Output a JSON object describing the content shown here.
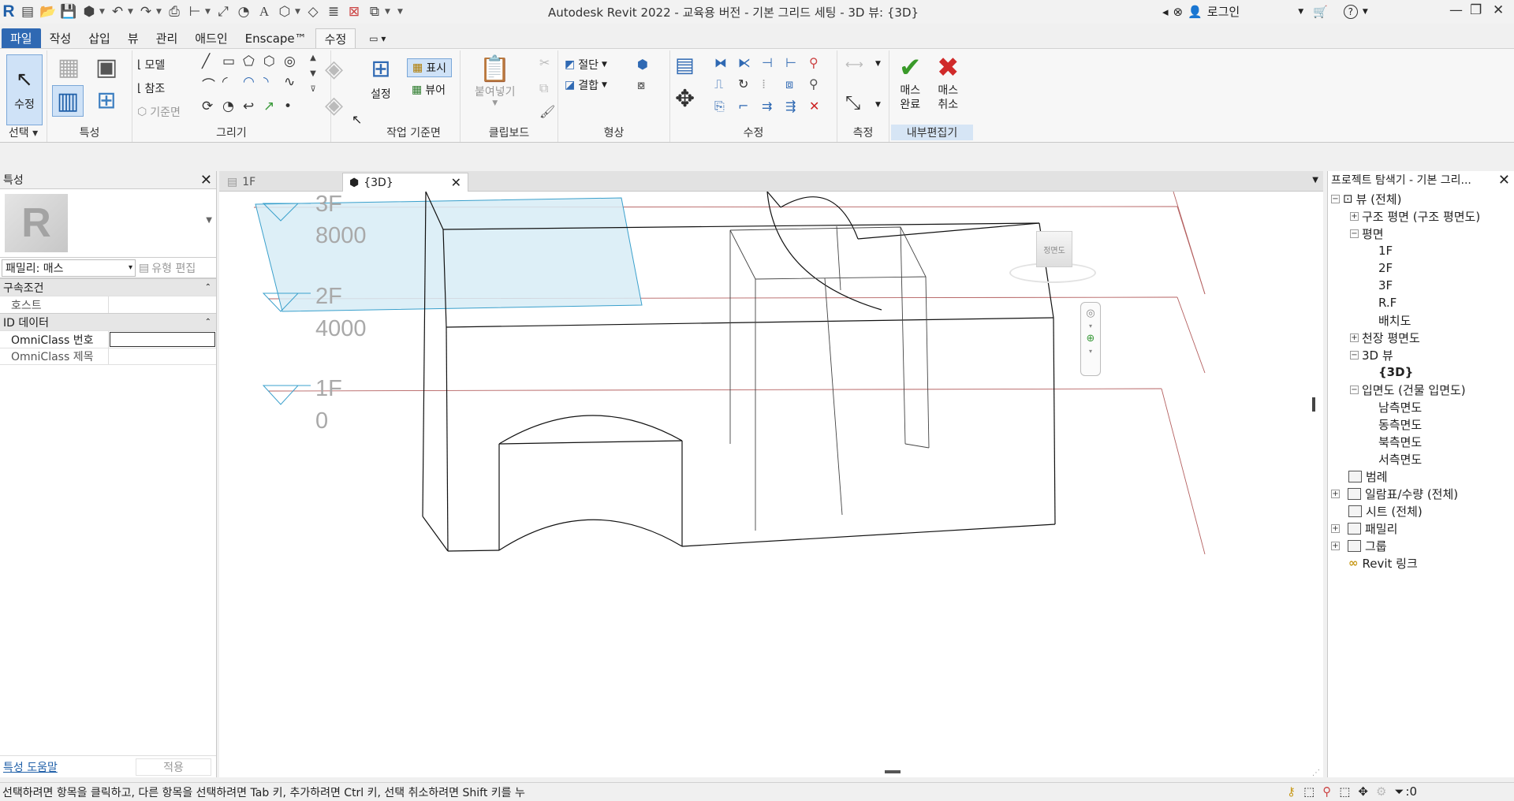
{
  "app": {
    "title": "Autodesk Revit 2022 - 교육용 버전 - 기본 그리드 세팅 - 3D 뷰: {3D}",
    "login": "로그인"
  },
  "colors": {
    "accent": "#2f69b3",
    "mass_fill": "#d7ecf6",
    "mass_stroke": "#3aa0cc",
    "level_line": "#b46060",
    "level_text": "#a9a9a9"
  },
  "ribbon_tabs": [
    "파일",
    "작성",
    "삽입",
    "뷰",
    "관리",
    "애드인",
    "Enscape™",
    "수정"
  ],
  "ribbon": {
    "select": {
      "modify_label": "수정",
      "panel": "선택"
    },
    "properties": {
      "panel": "특성"
    },
    "draw": {
      "model": "모델",
      "reference": "참조",
      "baseline": "기준면",
      "panel": "그리기"
    },
    "workplane": {
      "set": "설정",
      "show": "표시",
      "viewer": "뷰어",
      "panel": "작업 기준면"
    },
    "clipboard": {
      "paste": "붙여넣기",
      "panel": "클립보드"
    },
    "geometry": {
      "cut": "절단",
      "join": "결합",
      "panel": "형상"
    },
    "modify": {
      "panel": "수정"
    },
    "measure": {
      "panel": "측정"
    },
    "inplace": {
      "finish_1": "매스",
      "finish_2": "완료",
      "cancel_1": "매스",
      "cancel_2": "취소",
      "panel": "내부편집기"
    }
  },
  "properties": {
    "title": "특성",
    "family": "패밀리: 매스",
    "edit_type": "유형 편집",
    "sections": {
      "constraints": "구속조건",
      "id_data": "ID 데이터"
    },
    "rows": {
      "host": "호스트",
      "omni_num": "OmniClass 번호",
      "omni_title": "OmniClass 제목"
    },
    "help": "특성 도움말",
    "apply": "적용"
  },
  "view_tabs": [
    {
      "label": "1F"
    },
    {
      "label": "{3D}"
    }
  ],
  "levels": [
    {
      "name": "3F",
      "elevation": "8000"
    },
    {
      "name": "2F",
      "elevation": "4000"
    },
    {
      "name": "1F",
      "elevation": "0"
    }
  ],
  "viewcube_label": "정면도",
  "browser": {
    "title": "프로젝트 탐색기 - 기본 그리...",
    "views_all": "뷰 (전체)",
    "struct_plan": "구조 평면 (구조 평면도)",
    "plan": "평면",
    "plans": [
      "1F",
      "2F",
      "3F",
      "R.F",
      "배치도"
    ],
    "ceiling_plan": "천장 평면도",
    "view_3d": "3D 뷰",
    "view_3d_item": "{3D}",
    "elevation": "입면도 (건물 입면도)",
    "elevations": [
      "남측면도",
      "동측면도",
      "북측면도",
      "서측면도"
    ],
    "legend": "범례",
    "schedules": "일람표/수량 (전체)",
    "sheets": "시트 (전체)",
    "families": "패밀리",
    "groups": "그룹",
    "revit_links": "Revit 링크"
  },
  "status": {
    "hint": "선택하려면 항목을 클릭하고, 다른 항목을 선택하려면 Tab 키, 추가하려면 Ctrl 키, 선택 취소하려면 Shift 키를 누",
    "filter_count": ":0"
  }
}
